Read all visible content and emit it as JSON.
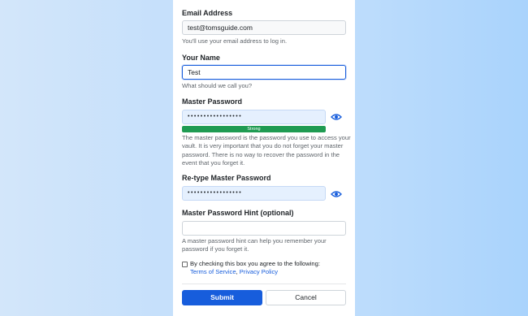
{
  "form": {
    "email": {
      "label": "Email Address",
      "value": "test@tomsguide.com",
      "help": "You'll use your email address to log in."
    },
    "name": {
      "label": "Your Name",
      "value": "Test",
      "help": "What should we call you?"
    },
    "master_password": {
      "label": "Master Password",
      "value": "•••••••••••••••••",
      "strength": "Strong",
      "strength_level": 1.0,
      "strength_color": "#1f9b52",
      "help_lines": [
        "The master password is the password you use to access your",
        "vault. It is very important that you do not forget your master",
        "password. There is no way to recover the password in the",
        "event that you forget it."
      ]
    },
    "retype_password": {
      "label": "Re-type Master Password",
      "value": "•••••••••••••••••"
    },
    "hint": {
      "label": "Master Password Hint (optional)",
      "value": "",
      "help_lines": [
        "A master password hint can help you remember your",
        "password if you forget it."
      ]
    },
    "terms": {
      "text": "By checking this box you agree to the following:",
      "terms_link": "Terms of Service",
      "separator": ",",
      "privacy_link": "Privacy Policy",
      "checked": false
    },
    "submit_label": "Submit",
    "cancel_label": "Cancel"
  },
  "colors": {
    "accent": "#175ddc",
    "strength_bar": "#1f9b52",
    "password_field_bg": "#e5f0fe"
  },
  "icons": {
    "password_toggle": "eye-icon"
  }
}
